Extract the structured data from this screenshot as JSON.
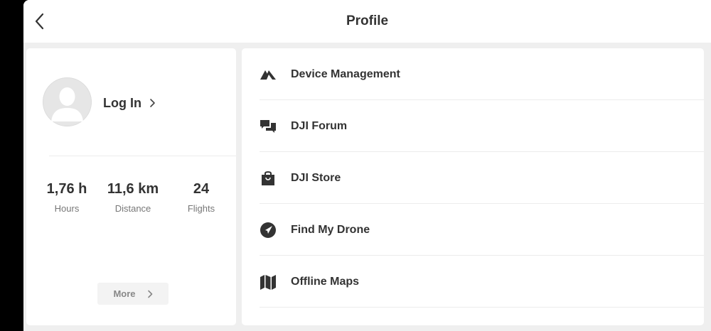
{
  "header": {
    "title": "Profile"
  },
  "profile": {
    "login_label": "Log In"
  },
  "stats": [
    {
      "value": "1,76 h",
      "label": "Hours"
    },
    {
      "value": "11,6 km",
      "label": "Distance"
    },
    {
      "value": "24",
      "label": "Flights"
    }
  ],
  "more_label": "More",
  "menu": [
    {
      "label": "Device Management",
      "icon": "device-management-icon"
    },
    {
      "label": "DJI Forum",
      "icon": "forum-chat-icon"
    },
    {
      "label": "DJI Store",
      "icon": "shopping-bag-icon"
    },
    {
      "label": "Find My Drone",
      "icon": "navigation-arrow-icon"
    },
    {
      "label": "Offline Maps",
      "icon": "map-icon"
    }
  ]
}
